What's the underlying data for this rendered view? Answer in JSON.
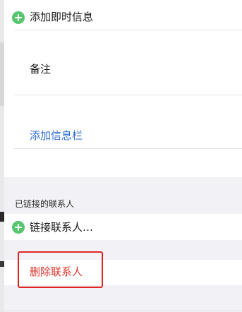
{
  "rows": {
    "add_instant_message": "添加即时信息",
    "note_label": "备注",
    "add_field": "添加信息栏",
    "linked_section_title": "已链接的联系人",
    "link_contact": "链接联系人…",
    "delete_contact": "删除联系人"
  },
  "colors": {
    "accent_green": "#57c46e",
    "link_blue": "#2f6fd0",
    "destructive_red": "#e0382e",
    "highlight_red": "#e02424",
    "group_background": "#f2f2f6"
  }
}
